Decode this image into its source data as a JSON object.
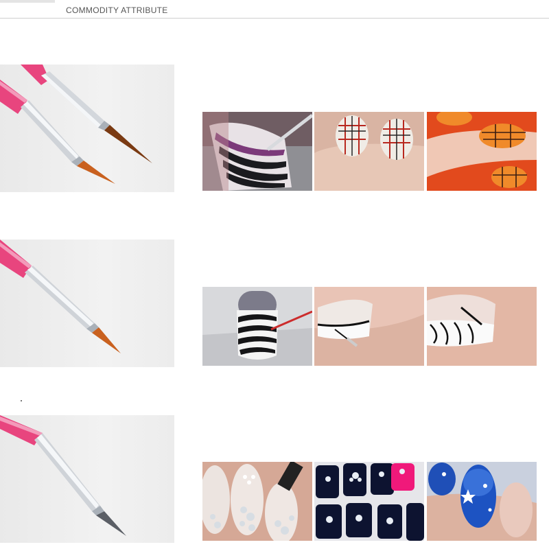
{
  "header": {
    "title": "COMMODITY ATTRIBUTE"
  },
  "brush_rows": [
    {
      "brush_image": "two-pink-liner-brushes",
      "examples": [
        "zebra-stripe-nail-art",
        "plaid-nail-art",
        "orange-plaid-nail-art"
      ]
    },
    {
      "brush_image": "single-pink-liner-brush",
      "examples": [
        "zebra-stripe-nail-art",
        "french-tip-line-art",
        "zebra-french-tip-art"
      ]
    },
    {
      "brush_image": "pink-dotting-brush",
      "examples": [
        "rhinestone-nail-art",
        "crystal-flower-nail-art",
        "blue-glitter-star-nail-art"
      ]
    }
  ],
  "colors": {
    "brush_pink": "#e8457e",
    "ferrule_silver": "#cfd3d8",
    "bristle_orange": "#c9611f",
    "background": "#ffffff"
  }
}
